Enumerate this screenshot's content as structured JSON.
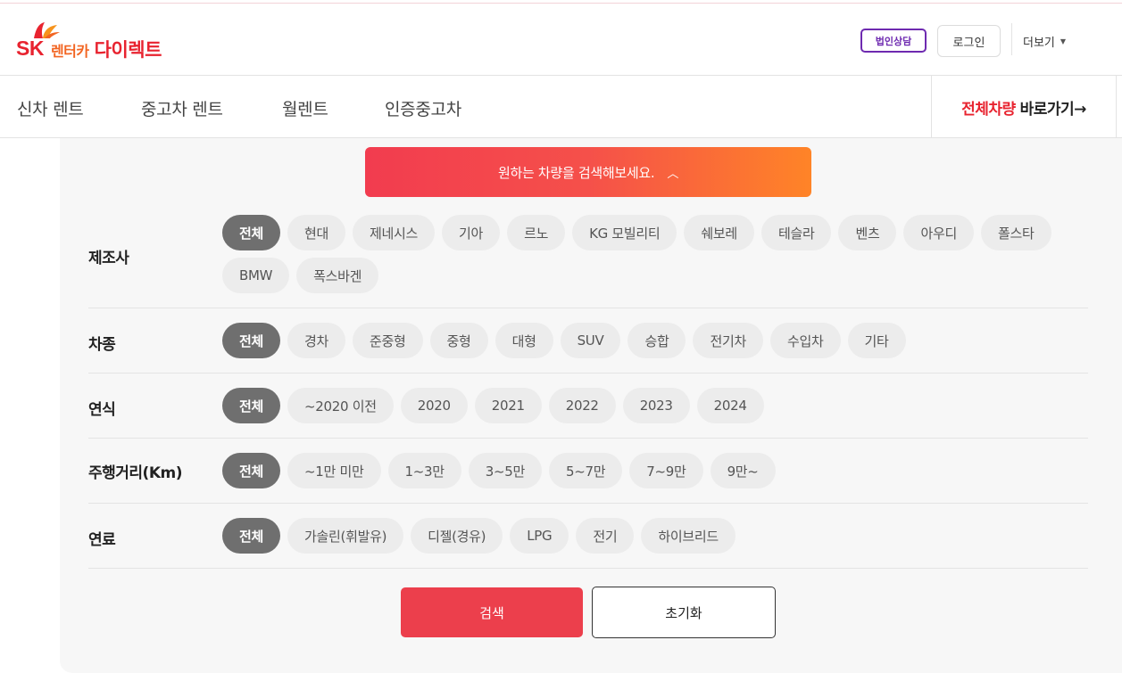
{
  "header": {
    "logo": {
      "sk": "SK",
      "rent": "렌터카",
      "direct": "다이렉트"
    },
    "biz_consult": "법인상담",
    "login": "로그인",
    "more": "더보기"
  },
  "nav": {
    "items": [
      {
        "label": "신차 렌트"
      },
      {
        "label": "중고차 렌트"
      },
      {
        "label": "월렌트"
      },
      {
        "label": "인증중고차"
      }
    ],
    "all_red": "전체차량",
    "all_black": "바로가기→"
  },
  "filter": {
    "toggle_label": "원하는 차량을 검색해보세요.",
    "rows": [
      {
        "label": "제조사",
        "options": [
          "전체",
          "현대",
          "제네시스",
          "기아",
          "르노",
          "KG 모빌리티",
          "쉐보레",
          "테슬라",
          "벤츠",
          "아우디",
          "폴스타",
          "BMW",
          "폭스바겐"
        ]
      },
      {
        "label": "차종",
        "options": [
          "전체",
          "경차",
          "준중형",
          "중형",
          "대형",
          "SUV",
          "승합",
          "전기차",
          "수입차",
          "기타"
        ]
      },
      {
        "label": "연식",
        "options": [
          "전체",
          "~2020 이전",
          "2020",
          "2021",
          "2022",
          "2023",
          "2024"
        ]
      },
      {
        "label": "주행거리(Km)",
        "options": [
          "전체",
          "~1만 미만",
          "1~3만",
          "3~5만",
          "5~7만",
          "7~9만",
          "9만~"
        ]
      },
      {
        "label": "연료",
        "options": [
          "전체",
          "가솔린(휘발유)",
          "디젤(경유)",
          "LPG",
          "전기",
          "하이브리드"
        ]
      }
    ],
    "selected": "전체",
    "search": "검색",
    "reset": "초기화"
  },
  "colors": {
    "brand_red": "#e8232f",
    "brand_orange": "#f26522",
    "biz_purple": "#6e2ab0",
    "chip_active": "#6f6f6f",
    "chip_idle": "#ececec"
  }
}
